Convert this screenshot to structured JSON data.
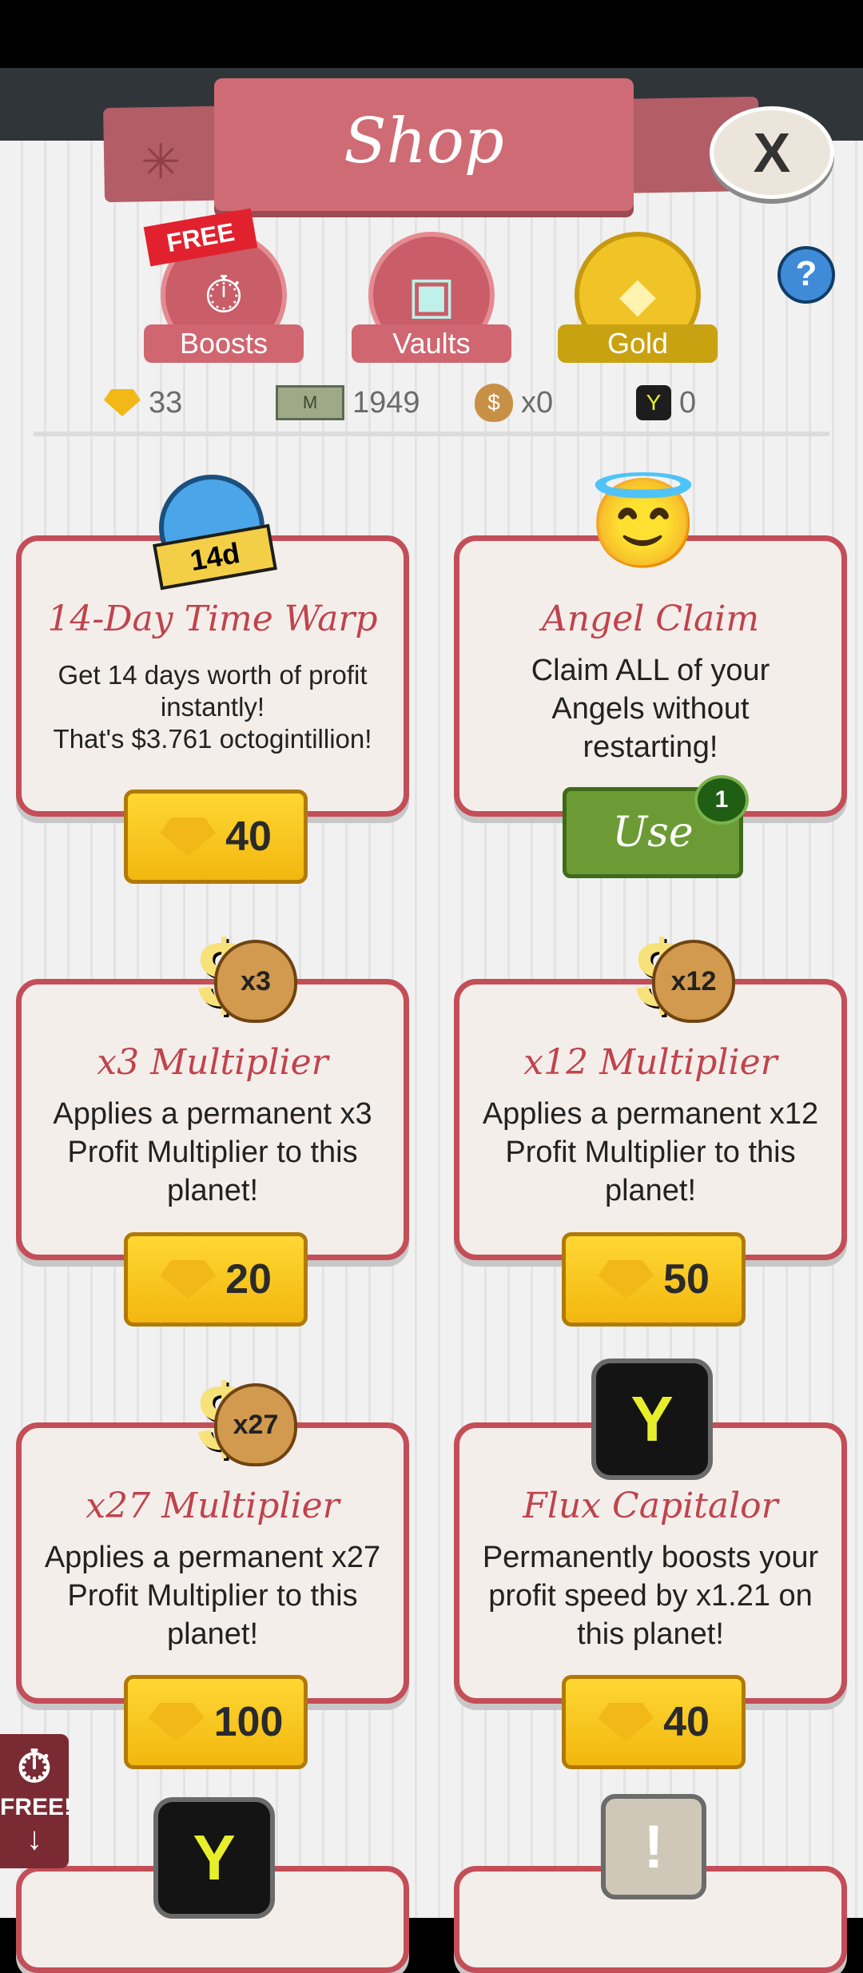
{
  "header": {
    "title": "Shop",
    "close_label": "X"
  },
  "tabs": [
    {
      "label": "Boosts",
      "ribbon": "FREE"
    },
    {
      "label": "Vaults"
    },
    {
      "label": "Gold"
    }
  ],
  "help": "?",
  "currencies": [
    {
      "icon": "gold-gem-icon",
      "value": "33"
    },
    {
      "icon": "megabucks-bill-icon",
      "bill_text": "M",
      "value": "1949"
    },
    {
      "icon": "money-bag-icon",
      "value": "x0"
    },
    {
      "icon": "flux-capitalor-icon",
      "value": "0"
    }
  ],
  "cards": [
    {
      "badge": "14d",
      "title": "14-Day Time Warp",
      "desc": "Get 14 days worth of profit instantly!\nThat's $3.761 octogintillion!",
      "price": "40"
    },
    {
      "title": "Angel Claim",
      "desc": "Claim ALL of your Angels without restarting!",
      "button": "Use",
      "count": "1"
    },
    {
      "bag": "x3",
      "title": "x3 Multiplier",
      "desc": "Applies a permanent x3 Profit Multiplier to this planet!",
      "price": "20"
    },
    {
      "bag": "x12",
      "title": "x12 Multiplier",
      "desc": "Applies a permanent x12 Profit Multiplier to this planet!",
      "price": "50"
    },
    {
      "bag": "x27",
      "title": "x27 Multiplier",
      "desc": "Applies a permanent x27 Profit Multiplier to this planet!",
      "price": "100"
    },
    {
      "title": "Flux Capitalor",
      "desc": "Permanently boosts your profit speed by x1.21 on this planet!",
      "price": "40"
    }
  ],
  "side_free": "FREE!",
  "colors": {
    "accent": "#c44e58",
    "gold": "#f2b70f",
    "use_green": "#6c9b35"
  }
}
